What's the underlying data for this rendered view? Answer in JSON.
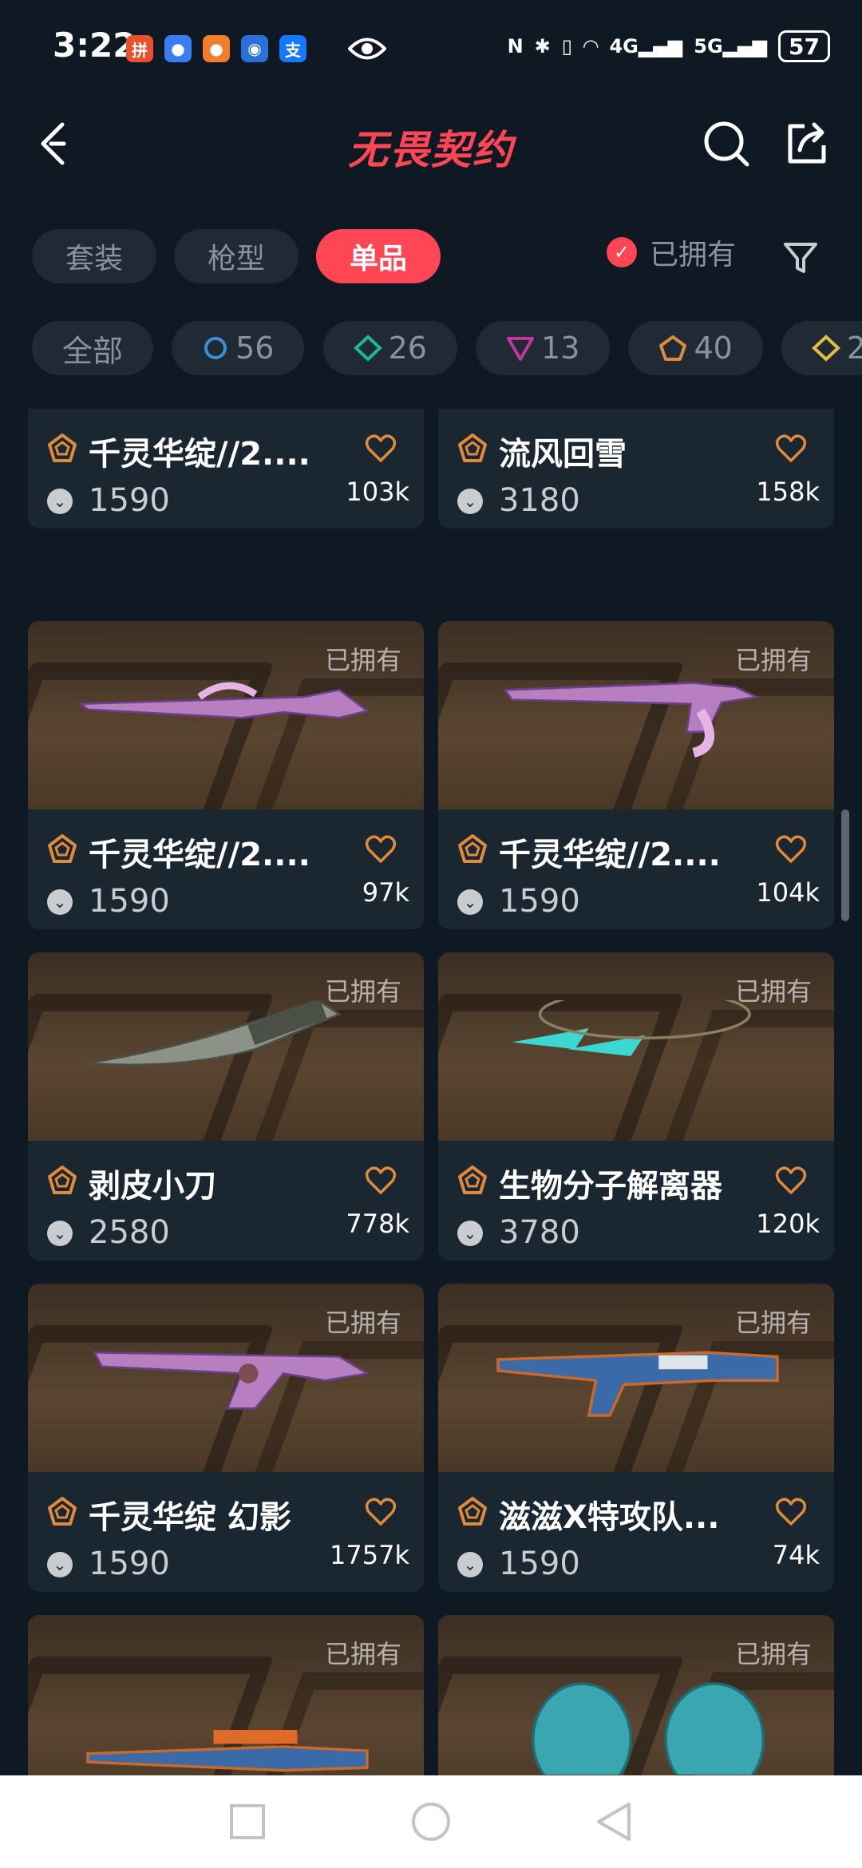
{
  "status_bar": {
    "time": "3:22",
    "battery": "57",
    "network_4g": "4G",
    "network_5g": "5G"
  },
  "header": {
    "title": "无畏契约"
  },
  "filters": {
    "tabs": [
      {
        "label": "套装",
        "active": false
      },
      {
        "label": "枪型",
        "active": false
      },
      {
        "label": "单品",
        "active": true
      }
    ],
    "owned_label": "已拥有"
  },
  "tiers": [
    {
      "label": "全部",
      "icon": "all"
    },
    {
      "label": "56",
      "icon": "select-tier-icon",
      "color": "#3a8fd6"
    },
    {
      "label": "26",
      "icon": "deluxe-tier-icon",
      "color": "#1fb59a"
    },
    {
      "label": "13",
      "icon": "premium-tier-icon",
      "color": "#c4379a"
    },
    {
      "label": "40",
      "icon": "exclusive-tier-icon",
      "color": "#e08a3b"
    },
    {
      "label": "2",
      "icon": "ultra-tier-icon",
      "color": "#e0c040"
    }
  ],
  "colors": {
    "accent": "#ff4655",
    "background": "#0f1923",
    "card": "#1a2630"
  },
  "owned_tag": "已拥有",
  "cards": [
    {
      "name": "千灵华绽//2....",
      "price": "1590",
      "likes": "103k",
      "owned": false,
      "weapon": "purple-blade"
    },
    {
      "name": "流风回雪",
      "price": "3180",
      "likes": "158k",
      "owned": false,
      "weapon": "pink-melee"
    },
    {
      "name": "千灵华绽//2....",
      "price": "1590",
      "likes": "97k",
      "owned": true,
      "weapon": "purple-rifle"
    },
    {
      "name": "千灵华绽//2....",
      "price": "1590",
      "likes": "104k",
      "owned": true,
      "weapon": "purple-pistol"
    },
    {
      "name": "剥皮小刀",
      "price": "2580",
      "likes": "778k",
      "owned": true,
      "weapon": "knife"
    },
    {
      "name": "生物分子解离器",
      "price": "3780",
      "likes": "120k",
      "owned": true,
      "weapon": "kunai"
    },
    {
      "name": "千灵华绽 幻影",
      "price": "1590",
      "likes": "1757k",
      "owned": true,
      "weapon": "purple-phantom"
    },
    {
      "name": "滋滋X特攻队...",
      "price": "1590",
      "likes": "74k",
      "owned": true,
      "weapon": "blue-rifle"
    },
    {
      "name": "",
      "price": "",
      "likes": "",
      "owned": true,
      "weapon": "blue-sniper"
    },
    {
      "name": "",
      "price": "",
      "likes": "",
      "owned": true,
      "weapon": "cyan-gloves"
    }
  ]
}
